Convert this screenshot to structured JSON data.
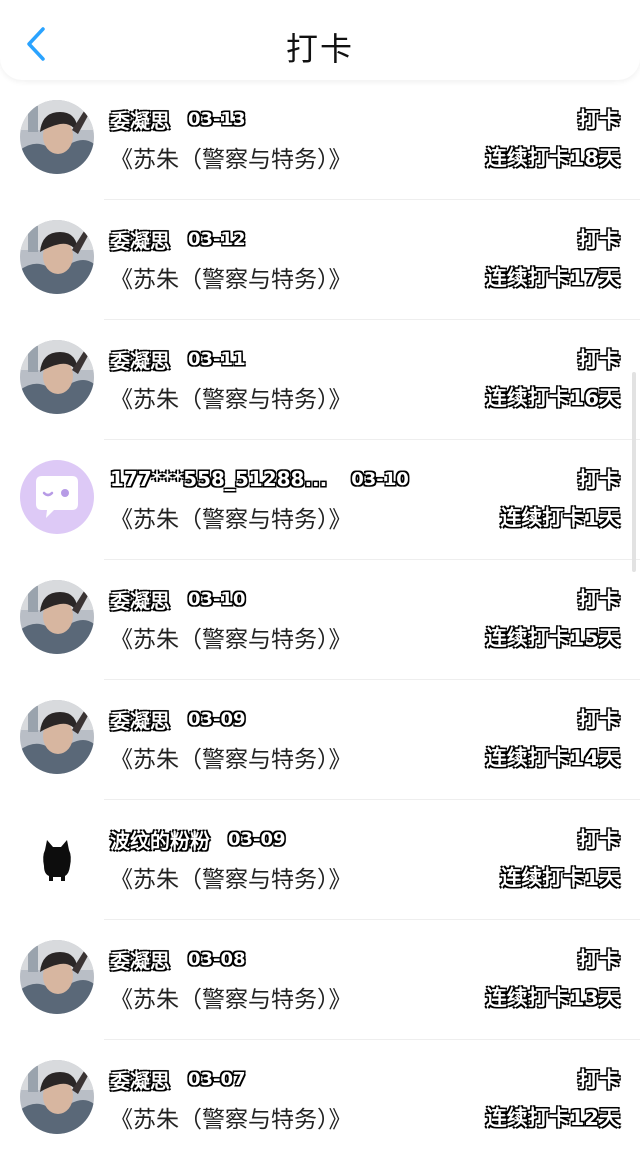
{
  "header": {
    "title": "打卡",
    "back_icon": "chevron-left-icon",
    "accent": "#2aa3ff"
  },
  "entries": [
    {
      "name": "委凝思",
      "date": "03-13",
      "book": "《苏朱（警察与特务）》",
      "action": "打卡",
      "streak": "连续打卡18天",
      "avatar": "photo"
    },
    {
      "name": "委凝思",
      "date": "03-12",
      "book": "《苏朱（警察与特务）》",
      "action": "打卡",
      "streak": "连续打卡17天",
      "avatar": "photo"
    },
    {
      "name": "委凝思",
      "date": "03-11",
      "book": "《苏朱（警察与特务）》",
      "action": "打卡",
      "streak": "连续打卡16天",
      "avatar": "photo"
    },
    {
      "name": "177***558_51288...",
      "date": "03-10",
      "book": "《苏朱（警察与特务）》",
      "action": "打卡",
      "streak": "连续打卡1天",
      "avatar": "chat-bubble"
    },
    {
      "name": "委凝思",
      "date": "03-10",
      "book": "《苏朱（警察与特务）》",
      "action": "打卡",
      "streak": "连续打卡15天",
      "avatar": "photo"
    },
    {
      "name": "委凝思",
      "date": "03-09",
      "book": "《苏朱（警察与特务）》",
      "action": "打卡",
      "streak": "连续打卡14天",
      "avatar": "photo"
    },
    {
      "name": "波纹的粉粉",
      "date": "03-09",
      "book": "《苏朱（警察与特务）》",
      "action": "打卡",
      "streak": "连续打卡1天",
      "avatar": "black-cat"
    },
    {
      "name": "委凝思",
      "date": "03-08",
      "book": "《苏朱（警察与特务）》",
      "action": "打卡",
      "streak": "连续打卡13天",
      "avatar": "photo"
    },
    {
      "name": "委凝思",
      "date": "03-07",
      "book": "《苏朱（警察与特务）》",
      "action": "打卡",
      "streak": "连续打卡12天",
      "avatar": "photo"
    }
  ]
}
